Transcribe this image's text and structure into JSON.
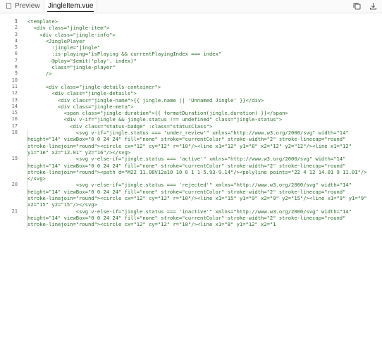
{
  "tabs": {
    "preview_label": "Preview",
    "file_label": "JingleItem.vue"
  },
  "toolbar": {
    "icons": [
      "copy-icon",
      "download-icon"
    ]
  },
  "code": {
    "lines": [
      {
        "n": "1",
        "text": "<template>"
      },
      {
        "n": "2",
        "text": "  <div class=\"jingle-item\">"
      },
      {
        "n": "3",
        "text": "    <div class=\"jingle-info\">"
      },
      {
        "n": "4",
        "text": "      <JinglePlayer"
      },
      {
        "n": "5",
        "text": "        :jingle=\"jingle\""
      },
      {
        "n": "6",
        "text": "        :is-playing=\"isPlaying && currentPlayingIndex === index\""
      },
      {
        "n": "7",
        "text": "        @play=\"$emit('play', index)\""
      },
      {
        "n": "8",
        "text": "        class=\"jingle-player\""
      },
      {
        "n": "9",
        "text": "      />"
      },
      {
        "n": "10",
        "text": ""
      },
      {
        "n": "11",
        "text": "      <div class=\"jingle-details-container\">"
      },
      {
        "n": "12",
        "text": "        <div class=\"jingle-details\">"
      },
      {
        "n": "13",
        "text": "          <div class=\"jingle-name\">{{ jingle.name || 'Unnamed Jingle' }}</div>"
      },
      {
        "n": "14",
        "text": "          <div class=\"jingle-meta\">"
      },
      {
        "n": "15",
        "text": "            <span class=\"jingle-duration\">{{ formatDuration(jingle.duration) }}</span>"
      },
      {
        "n": "16",
        "text": "            <div v-if=\"jingle && jingle.status !== undefined\" class=\"jingle-status\">"
      },
      {
        "n": "17",
        "text": "              <div class=\"status-badge\" :class=\"statusClass\">"
      },
      {
        "n": "18",
        "text": "                <svg v-if=\"jingle.status === 'under_review'\" xmlns=\"http://www.w3.org/2000/svg\" width=\"14\" height=\"14\" viewBox=\"0 0 24 24\" fill=\"none\" stroke=\"currentColor\" stroke-width=\"2\" stroke-linecap=\"round\" stroke-linejoin=\"round\"><circle cx=\"12\" cy=\"12\" r=\"10\"/><line x1=\"12\" y1=\"8\" x2=\"12\" y2=\"12\"/><line x1=\"12\" y1=\"16\" x2=\"12.01\" y2=\"16\"/></svg>"
      },
      {
        "n": "19",
        "text": "                <svg v-else-if=\"jingle.status === 'active'\" xmlns=\"http://www.w3.org/2000/svg\" width=\"14\" height=\"14\" viewBox=\"0 0 24 24\" fill=\"none\" stroke=\"currentColor\" stroke-width=\"2\" stroke-linecap=\"round\" stroke-linejoin=\"round\"><path d=\"M22 11.08V12a10 10 0 1 1-5.93-9.14\"/><polyline points=\"22 4 12 14.01 9 11.01\"/></svg>"
      },
      {
        "n": "20",
        "text": "                <svg v-else-if=\"jingle.status === 'rejected'\" xmlns=\"http://www.w3.org/2000/svg\" width=\"14\" height=\"14\" viewBox=\"0 0 24 24\" fill=\"none\" stroke=\"currentColor\" stroke-width=\"2\" stroke-linecap=\"round\" stroke-linejoin=\"round\"><circle cx=\"12\" cy=\"12\" r=\"10\"/><line x1=\"15\" y1=\"9\" x2=\"9\" y2=\"15\"/><line x1=\"9\" y1=\"9\" x2=\"15\" y2=\"15\"/></svg>"
      },
      {
        "n": "21",
        "text": "                <svg v-else-if=\"jingle.status === 'inactive'\" xmlns=\"http://www.w3.org/2000/svg\" width=\"14\" height=\"14\" viewBox=\"0 0 24 24\" fill=\"none\" stroke=\"currentColor\" stroke-width=\"2\" stroke-linecap=\"round\" stroke-linejoin=\"round\"><circle cx=\"12\" cy=\"12\" r=\"10\"/><line x1=\"8\" y1=\"12\" x2=\"1"
      }
    ]
  }
}
